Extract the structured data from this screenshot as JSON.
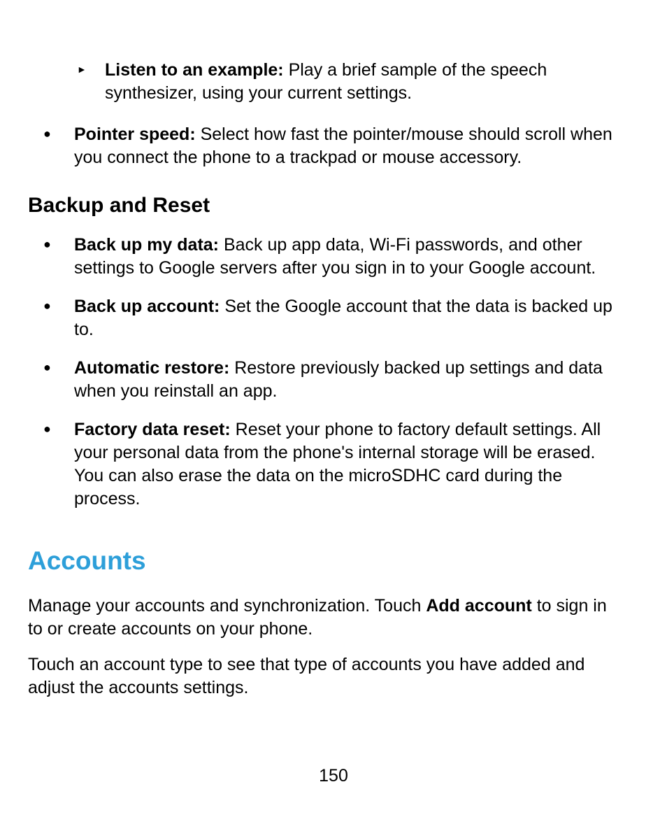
{
  "subItem": {
    "marker": "►",
    "label": "Listen to an example:",
    "text": " Play a brief sample of the speech synthesizer, using your current settings."
  },
  "topBullet": {
    "marker": "●",
    "label": "Pointer speed:",
    "text": " Select how fast the pointer/mouse should scroll when you connect the phone to a trackpad or mouse accessory."
  },
  "heading2": "Backup and Reset",
  "bullets": [
    {
      "marker": "●",
      "label": "Back up my data:",
      "text": " Back up app data, Wi-Fi passwords, and other settings to Google servers after you sign in to your Google account."
    },
    {
      "marker": "●",
      "label": "Back up account:",
      "text": " Set the Google account that the data is backed up to."
    },
    {
      "marker": "●",
      "label": "Automatic restore:",
      "text": " Restore previously backed up settings and data when you reinstall an app."
    },
    {
      "marker": "●",
      "label": "Factory data reset:",
      "text": " Reset your phone to factory default settings. All your personal data from the phone's internal storage will be erased. You can also erase the data on the microSDHC card during the process."
    }
  ],
  "heading1": "Accounts",
  "para1_pre": "Manage your accounts and synchronization. Touch ",
  "para1_bold": "Add account",
  "para1_post": " to sign in to or create accounts on your phone.",
  "para2": "Touch an account type to see that type of accounts you have added and adjust the accounts settings.",
  "pageNumber": "150"
}
